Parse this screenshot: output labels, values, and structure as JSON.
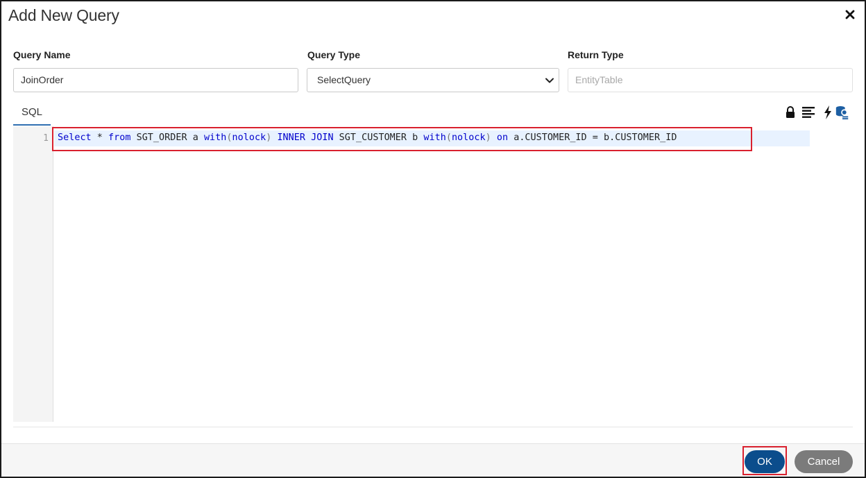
{
  "dialog": {
    "title": "Add New Query",
    "close_icon": "close-icon"
  },
  "fields": {
    "query_name": {
      "label": "Query Name",
      "value": "JoinOrder"
    },
    "query_type": {
      "label": "Query Type",
      "value": "SelectQuery",
      "icon": "chevron-down-icon"
    },
    "return_type": {
      "label": "Return Type",
      "placeholder": "EntityTable"
    }
  },
  "editor": {
    "tab_label": "SQL",
    "toolbar_icons": [
      "lock-icon",
      "format-align-icon",
      "lightning-icon",
      "database-settings-icon"
    ],
    "line_numbers": [
      "1"
    ],
    "code_tokens": {
      "select": "Select",
      "star": " * ",
      "from": "from",
      "t1": " SGT_ORDER a ",
      "with1": "with",
      "lp1": "(",
      "nolock1": "nolock",
      "rp1": ")",
      "sp1": " ",
      "inner_join": "INNER JOIN",
      "t2": " SGT_CUSTOMER b ",
      "with2": "with",
      "lp2": "(",
      "nolock2": "nolock",
      "rp2": ")",
      "sp2": " ",
      "on": "on",
      "cond": " a.CUSTOMER_ID = b.CUSTOMER_ID"
    }
  },
  "footer": {
    "ok_label": "OK",
    "cancel_label": "Cancel"
  },
  "colors": {
    "accent": "#0b4d8c",
    "highlight_border": "#d9202e",
    "keyword": "#0000cc",
    "cancel_bg": "#7b7b7b"
  }
}
